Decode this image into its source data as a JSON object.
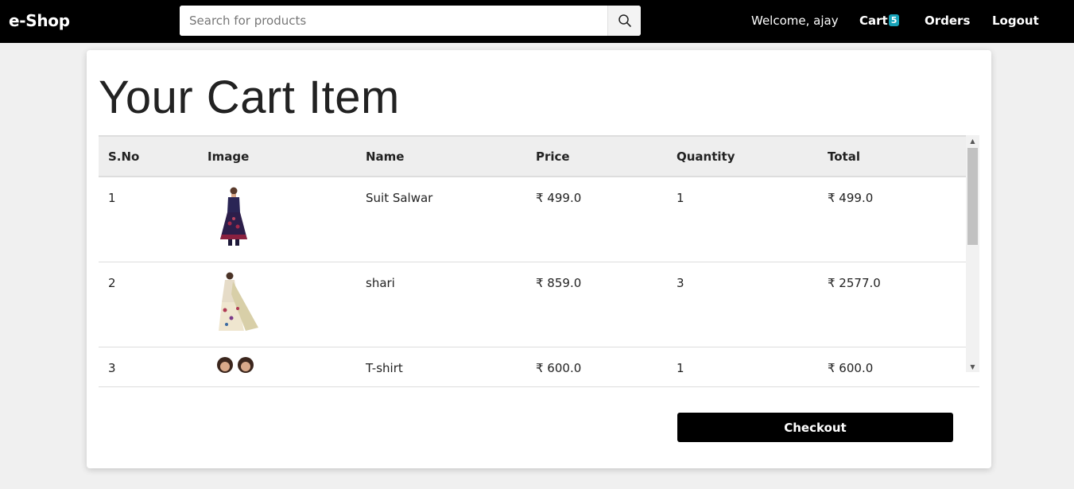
{
  "navbar": {
    "brand": "e-Shop",
    "search": {
      "placeholder": "Search for products",
      "value": ""
    },
    "search_icon": "search-icon",
    "welcome": "Welcome, ajay",
    "cart_label": "Cart",
    "cart_count": "5",
    "orders_label": "Orders",
    "logout_label": "Logout"
  },
  "main": {
    "title": "Your Cart Item",
    "columns": [
      "S.No",
      "Image",
      "Name",
      "Price",
      "Quantity",
      "Total"
    ],
    "rows": [
      {
        "sno": "1",
        "image": "suit-salwar-thumbnail",
        "name": "Suit Salwar",
        "price": "₹ 499.0",
        "quantity": "1",
        "total": "₹ 499.0"
      },
      {
        "sno": "2",
        "image": "saree-thumbnail",
        "name": "shari",
        "price": "₹ 859.0",
        "quantity": "3",
        "total": "₹ 2577.0"
      },
      {
        "sno": "3",
        "image": "tshirt-thumbnail",
        "name": "T-shirt",
        "price": "₹ 600.0",
        "quantity": "1",
        "total": "₹ 600.0"
      }
    ],
    "checkout_label": "Checkout"
  },
  "colors": {
    "navbar_bg": "#000000",
    "badge": "#17a2b8",
    "page_bg": "#f0f0f0",
    "table_header_bg": "#eeeeee",
    "checkout_bg": "#000000"
  }
}
